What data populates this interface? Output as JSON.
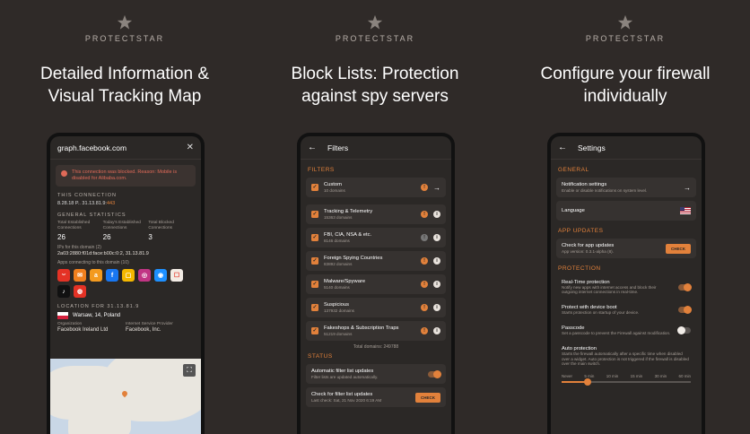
{
  "brand": "PROTECTSTAR",
  "colors": {
    "background": "#2f2a28",
    "accent": "#e2813b",
    "alert": "#e06a58"
  },
  "panels": [
    {
      "headline_line1": "Detailed Information &",
      "headline_line2": "Visual Tracking Map",
      "screen": {
        "title": "graph.facebook.com",
        "alert": "This connection was blocked. Reason: Mobile is disabled for Alibaba.com.",
        "this_connection_label": "THIS CONNECTION",
        "connection_ip": "8.28.18 P.. 31.13.81.9",
        "connection_port": "443",
        "general_stats_label": "GENERAL STATISTICS",
        "stats": [
          {
            "label": "Total Established Connections",
            "value": "26"
          },
          {
            "label": "Today's Established Connections",
            "value": "26"
          },
          {
            "label": "Total Blocked Connections",
            "value": "3"
          }
        ],
        "ips_label": "IPs for this domain (2)",
        "ips_value": "2a03:2880:f01d:face:b00c:0:2, 31.13.81.9",
        "apps_label": "Apps connecting to this domain (10)",
        "location_label": "LOCATION FOR 31.13.81.9",
        "location_value": "Warsaw, 14, Poland",
        "org_label": "Organization",
        "org_value": "Facebook Ireland Ltd",
        "isp_label": "Internet Service Provider",
        "isp_value": "Facebook, Inc."
      }
    },
    {
      "headline_line1": "Block Lists: Protection",
      "headline_line2": "against spy servers",
      "screen": {
        "title": "Filters",
        "filters_label": "FILTERS",
        "filters": [
          {
            "name": "Custom",
            "count": "10 domains"
          },
          {
            "name": "Tracking & Telemetry",
            "count": "15363 domains"
          },
          {
            "name": "FBI, CIA, NSA & etc.",
            "count": "8146 domains"
          },
          {
            "name": "Foreign Spying Countries",
            "count": "83892 domains"
          },
          {
            "name": "Malware/Spyware",
            "count": "5140 domains"
          },
          {
            "name": "Suspicious",
            "count": "137932 domains"
          },
          {
            "name": "Fakeshops & Subscription Traps",
            "count": "51219 domains"
          }
        ],
        "total": "Total domains: 249788",
        "status_label": "STATUS",
        "auto_title": "Automatic filter list updates",
        "auto_sub": "Filter lists are updated automatically.",
        "check_title": "Check for filter list updates",
        "check_sub": "Last check: Sat, 21 Nov 2020 6:19 AM",
        "check_button": "CHECK"
      }
    },
    {
      "headline_line1": "Configure your firewall",
      "headline_line2": "individually",
      "screen": {
        "title": "Settings",
        "general_label": "GENERAL",
        "notif_title": "Notification settings",
        "notif_sub": "Enable or disable notifications on system level.",
        "language_title": "Language",
        "updates_label": "APP UPDATES",
        "app_update_title": "Check for app updates",
        "app_update_sub": "App version: 0.3.1-alpha (8).",
        "app_update_button": "CHECK",
        "protection_label": "PROTECTION",
        "realtime_title": "Real-Time protection",
        "realtime_sub": "Notify new apps with internet access and block their outgoing internet connections in real-time.",
        "boot_title": "Protect with device boot",
        "boot_sub": "Starts protection on startup of your device.",
        "passcode_title": "Passcode",
        "passcode_sub": "Set a passcode to prevent the Firewall against modification.",
        "auto_title": "Auto protection",
        "auto_sub": "Starts the firewall automatically after a specific time when disabled over a widget. Auto protection is not triggered if the firewall is disabled over the main switch.",
        "slider_labels": [
          "Never",
          "5 min",
          "10 min",
          "15 min",
          "30 min",
          "60 min"
        ],
        "slider_value_fraction": 0.2
      }
    }
  ]
}
